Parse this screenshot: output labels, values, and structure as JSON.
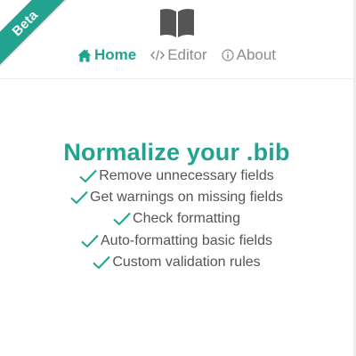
{
  "ribbon": {
    "label": "Beta"
  },
  "header": {
    "logo_icon": "open-book-icon",
    "nav": [
      {
        "label": "Home",
        "icon": "home-icon",
        "active": true
      },
      {
        "label": "Editor",
        "icon": "code-icon",
        "active": false
      },
      {
        "label": "About",
        "icon": "info-icon",
        "active": false
      }
    ]
  },
  "main": {
    "title": "Normalize your .bib",
    "features": [
      "Remove unnecessary fields",
      "Get warnings on missing fields",
      "Check formatting",
      "Auto-formatting basic fields",
      "Custom validation rules"
    ],
    "check_icon": "check-icon"
  },
  "colors": {
    "accent": "#21a38f",
    "nav_inactive": "#8c8c8c",
    "text": "#555555",
    "logo": "#555555"
  }
}
